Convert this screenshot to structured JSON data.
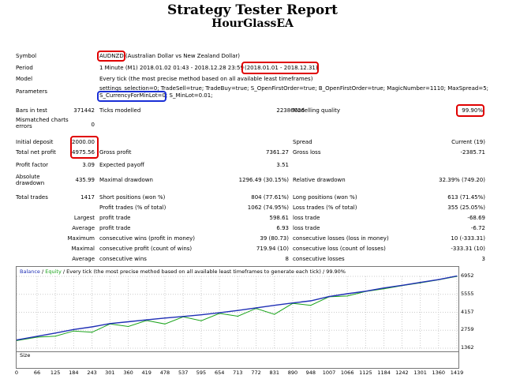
{
  "report": {
    "title": "Strategy Tester Report",
    "subtitle": "HourGlassEA"
  },
  "info": {
    "symbol_label": "Symbol",
    "symbol_code": "AUDNZD",
    "symbol_desc": " (Australian Dollar vs New Zealand Dollar)",
    "period_label": "Period",
    "period_text": "1 Minute (M1) 2018.01.02 01:43 - 2018.12.28 23:59",
    "period_range": "(2018.01.01 - 2018.12.31)",
    "model_label": "Model",
    "model_text": "Every tick (the most precise method based on all available least timeframes)",
    "params_label": "Parameters",
    "params_line1": "settings_selection=0; TradeSell=true; TradeBuy=true; S_OpenFirstOrder=true; B_OpenFirstOrder=true; MagicNumber=1110; MaxSpread=5;",
    "params_highlight": "S_CurrencyForMinLot=0;",
    "params_rest": " S_MinLot=0.01;",
    "bars_label": "Bars in test",
    "bars_value": "371442",
    "ticks_label": "Ticks modelled",
    "ticks_value": "22386026",
    "quality_label": "Modelling quality",
    "quality_value": "99.90%",
    "mismatch_label": "Mismatched charts errors",
    "mismatch_value": "0"
  },
  "stats": {
    "initial_deposit_label": "Initial deposit",
    "initial_deposit": "2000.00",
    "spread_label": "Spread",
    "spread_value": "Current (19)",
    "net_profit_label": "Total net profit",
    "net_profit": "4975.56",
    "gross_profit_label": "Gross profit",
    "gross_profit": "7361.27",
    "gross_loss_label": "Gross loss",
    "gross_loss": "-2385.71",
    "profit_factor_label": "Profit factor",
    "profit_factor": "3.09",
    "expected_payoff_label": "Expected payoff",
    "expected_payoff": "3.51",
    "abs_drawdown_label": "Absolute drawdown",
    "abs_drawdown": "435.99",
    "max_drawdown_label": "Maximal drawdown",
    "max_drawdown": "1296.49 (30.15%)",
    "rel_drawdown_label": "Relative drawdown",
    "rel_drawdown": "32.39% (749.20)",
    "total_trades_label": "Total trades",
    "total_trades": "1417",
    "short_label": "Short positions (won %)",
    "short_value": "804 (77.61%)",
    "long_label": "Long positions (won %)",
    "long_value": "613 (71.45%)",
    "profit_trades_label": "Profit trades (% of total)",
    "profit_trades": "1062 (74.95%)",
    "loss_trades_label": "Loss trades (% of total)",
    "loss_trades": "355 (25.05%)",
    "largest_label": "Largest",
    "largest_profit_label": "profit trade",
    "largest_profit": "598.61",
    "largest_loss_label": "loss trade",
    "largest_loss": "-68.69",
    "average_label": "Average",
    "average_profit_label": "profit trade",
    "average_profit": "6.93",
    "average_loss_label": "loss trade",
    "average_loss": "-6.72",
    "maximum_label": "Maximum",
    "max_cons_wins_label": "consecutive wins (profit in money)",
    "max_cons_wins": "39 (80.73)",
    "max_cons_losses_label": "consecutive losses (loss in money)",
    "max_cons_losses": "10 (-333.31)",
    "maximal_label": "Maximal",
    "maximal_cons_profit_label": "consecutive profit (count of wins)",
    "maximal_cons_profit": "719.94 (10)",
    "maximal_cons_loss_label": "consecutive loss (count of losses)",
    "maximal_cons_loss": "-333.31 (10)",
    "avg_label": "Average",
    "avg_cons_wins_label": "consecutive wins",
    "avg_cons_wins": "8",
    "avg_cons_losses_label": "consecutive losses",
    "avg_cons_losses": "3"
  },
  "chart_data": {
    "type": "line",
    "header": {
      "balance": "Balance",
      "sep1": " / ",
      "equity": "Equity",
      "rest": " / Every tick (the most precise method based on all available least timeframes to generate each tick) / 99.90%"
    },
    "series": [
      {
        "name": "Balance",
        "color": "#1f2fb5",
        "x": [
          0,
          66,
          125,
          184,
          243,
          301,
          360,
          419,
          478,
          537,
          595,
          654,
          713,
          772,
          831,
          890,
          948,
          1007,
          1066,
          1125,
          1184,
          1242,
          1301,
          1360,
          1419
        ],
        "values": [
          2000,
          2290,
          2540,
          2820,
          3020,
          3280,
          3420,
          3570,
          3710,
          3830,
          3960,
          4120,
          4300,
          4500,
          4700,
          4880,
          5050,
          5380,
          5600,
          5800,
          6050,
          6250,
          6480,
          6700,
          6980
        ]
      },
      {
        "name": "Equity",
        "color": "#1aa31a",
        "x": [
          0,
          66,
          125,
          184,
          243,
          301,
          360,
          419,
          478,
          537,
          595,
          654,
          713,
          772,
          831,
          890,
          948,
          1007,
          1066,
          1125,
          1184,
          1242,
          1301,
          1360,
          1419
        ],
        "values": [
          1950,
          2220,
          2300,
          2700,
          2600,
          3250,
          3050,
          3520,
          3250,
          3800,
          3500,
          4070,
          3850,
          4460,
          4000,
          4850,
          4700,
          5360,
          5420,
          5780,
          5980,
          6230,
          6440,
          6680,
          6950
        ]
      }
    ],
    "y_ticks": [
      "6952",
      "5555",
      "4157",
      "2759",
      "1362"
    ],
    "ylim": [
      1362,
      6952
    ],
    "xlim": [
      0,
      1419
    ],
    "x_ticks": [
      "0",
      "66",
      "125",
      "184",
      "243",
      "301",
      "360",
      "419",
      "478",
      "537",
      "595",
      "654",
      "713",
      "772",
      "831",
      "890",
      "948",
      "1007",
      "1066",
      "1125",
      "1184",
      "1242",
      "1301",
      "1360",
      "1419"
    ],
    "size_label": "Size",
    "grid": true
  }
}
